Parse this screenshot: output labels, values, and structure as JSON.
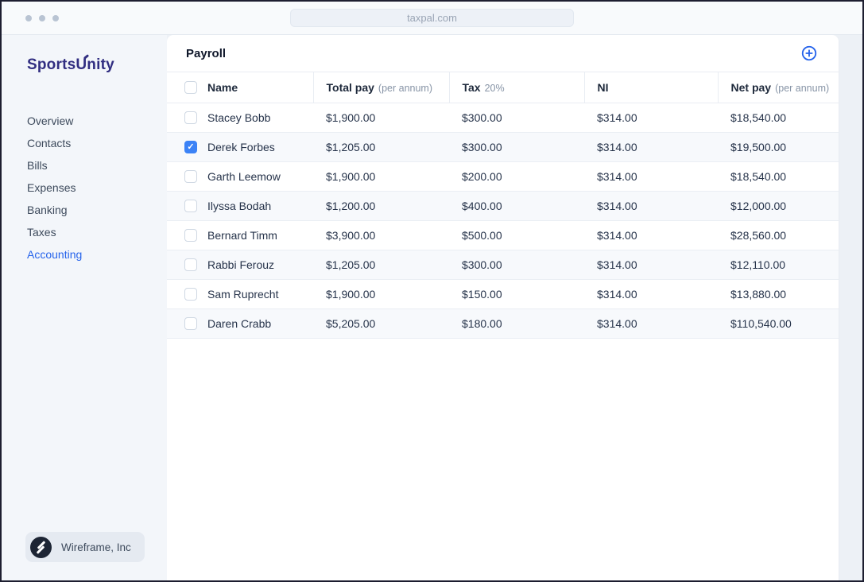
{
  "browser": {
    "url": "taxpal.com"
  },
  "sidebar": {
    "logo": {
      "part1": "Sports",
      "part2": "U",
      "part3": "nity"
    },
    "items": [
      {
        "label": "Overview",
        "active": false
      },
      {
        "label": "Contacts",
        "active": false
      },
      {
        "label": "Bills",
        "active": false
      },
      {
        "label": "Expenses",
        "active": false
      },
      {
        "label": "Banking",
        "active": false
      },
      {
        "label": "Taxes",
        "active": false
      },
      {
        "label": "Accounting",
        "active": true
      }
    ],
    "org": {
      "name": "Wireframe, Inc",
      "logo_icon": "wireframe-circle-slashes-icon"
    }
  },
  "main": {
    "title": "Payroll",
    "add_button_icon": "circle-plus-icon",
    "table": {
      "columns": [
        {
          "label": "Name",
          "sub": ""
        },
        {
          "label": "Total pay",
          "sub": "(per annum)"
        },
        {
          "label": "Tax",
          "sub": "20%"
        },
        {
          "label": "NI",
          "sub": ""
        },
        {
          "label": "Net pay",
          "sub": "(per annum)"
        }
      ],
      "rows": [
        {
          "checked": false,
          "name": "Stacey Bobb",
          "total_pay": "$1,900.00",
          "tax": "$300.00",
          "ni": "$314.00",
          "net_pay": "$18,540.00"
        },
        {
          "checked": true,
          "name": "Derek Forbes",
          "total_pay": "$1,205.00",
          "tax": "$300.00",
          "ni": "$314.00",
          "net_pay": "$19,500.00"
        },
        {
          "checked": false,
          "name": "Garth Leemow",
          "total_pay": "$1,900.00",
          "tax": "$200.00",
          "ni": "$314.00",
          "net_pay": "$18,540.00"
        },
        {
          "checked": false,
          "name": "Ilyssa Bodah",
          "total_pay": "$1,200.00",
          "tax": "$400.00",
          "ni": "$314.00",
          "net_pay": "$12,000.00"
        },
        {
          "checked": false,
          "name": "Bernard Timm",
          "total_pay": "$3,900.00",
          "tax": "$500.00",
          "ni": "$314.00",
          "net_pay": "$28,560.00"
        },
        {
          "checked": false,
          "name": "Rabbi Ferouz",
          "total_pay": "$1,205.00",
          "tax": "$300.00",
          "ni": "$314.00",
          "net_pay": "$12,110.00"
        },
        {
          "checked": false,
          "name": "Sam Ruprecht",
          "total_pay": "$1,900.00",
          "tax": "$150.00",
          "ni": "$314.00",
          "net_pay": "$13,880.00"
        },
        {
          "checked": false,
          "name": "Daren Crabb",
          "total_pay": "$5,205.00",
          "tax": "$180.00",
          "ni": "$314.00",
          "net_pay": "$110,540.00"
        }
      ]
    }
  },
  "colors": {
    "accent_blue": "#2563eb",
    "checkbox_checked_blue": "#3b82f6",
    "logo_indigo": "#312e81",
    "stripe_row": "#f7f9fc",
    "window_border": "#1d1e30"
  }
}
